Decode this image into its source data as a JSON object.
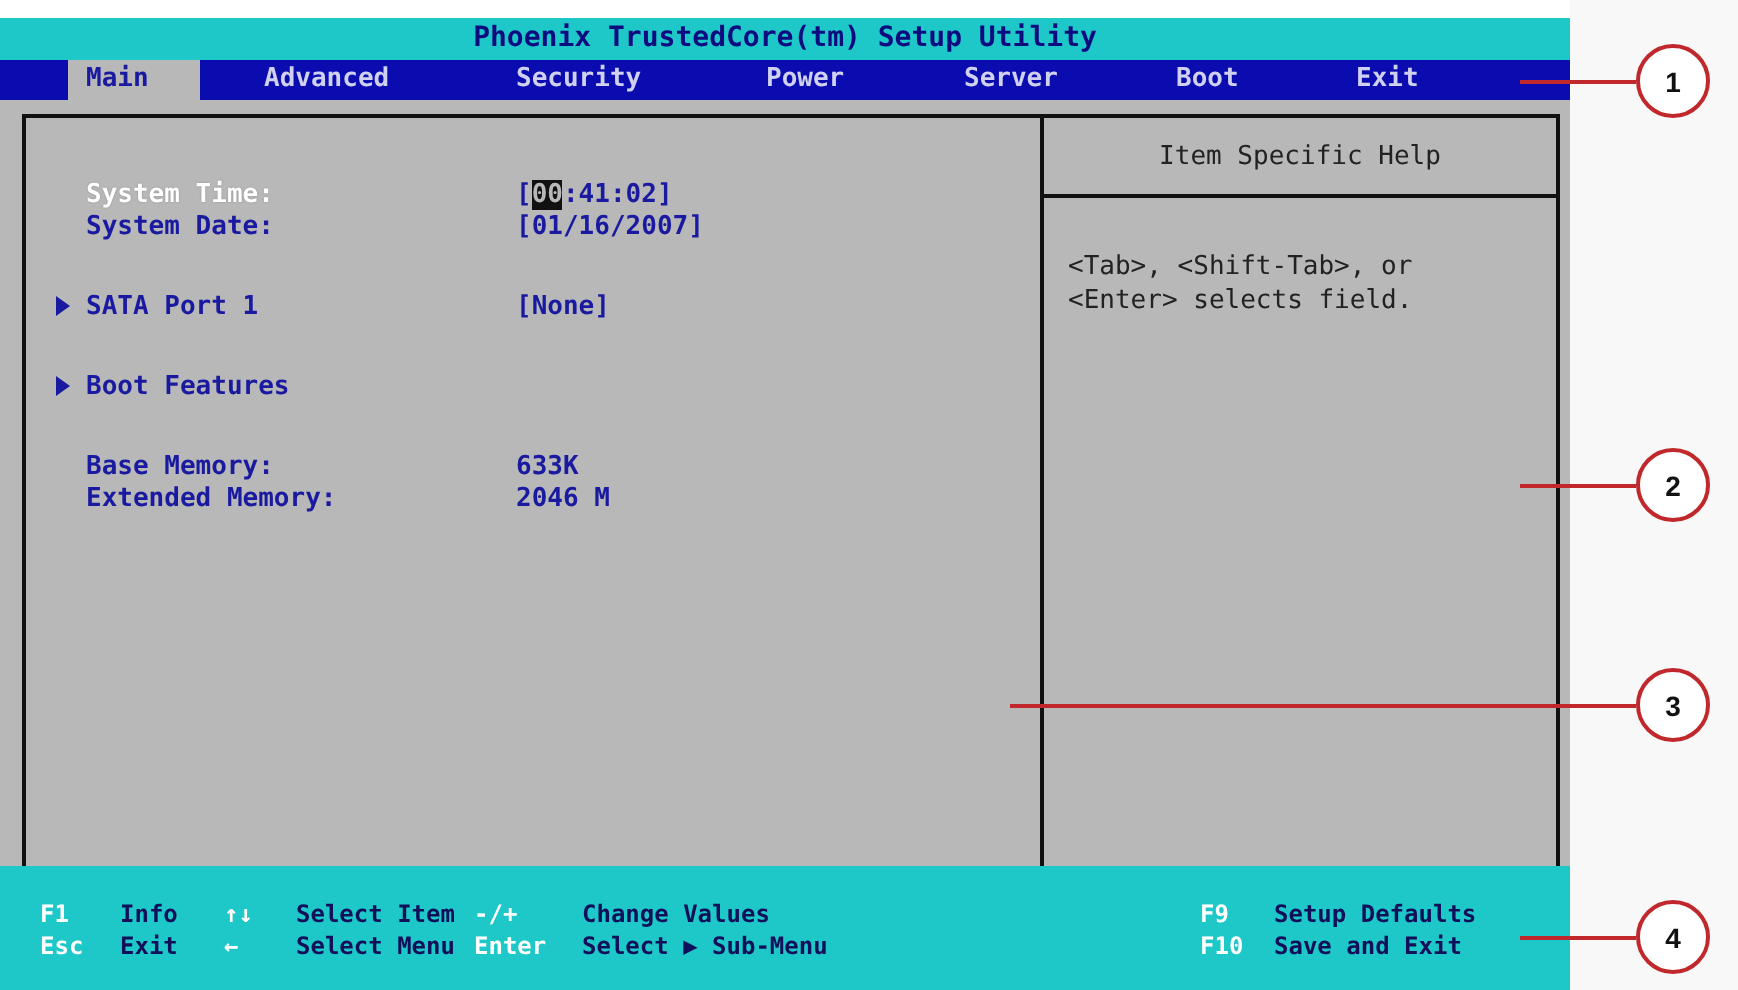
{
  "window": {
    "title": "Phoenix TrustedCore(tm) Setup Utility"
  },
  "menu": [
    {
      "label": "Main",
      "selected": true
    },
    {
      "label": "Advanced",
      "selected": false
    },
    {
      "label": "Security",
      "selected": false
    },
    {
      "label": "Power",
      "selected": false
    },
    {
      "label": "Server",
      "selected": false
    },
    {
      "label": "Boot",
      "selected": false
    },
    {
      "label": "Exit",
      "selected": false
    }
  ],
  "items": [
    {
      "kind": "field",
      "label": "System Time:",
      "selected": true,
      "value_parts": [
        {
          "text": "[",
          "selected": false
        },
        {
          "text": "00",
          "selected": true
        },
        {
          "text": ":41:02]",
          "selected": false
        }
      ]
    },
    {
      "kind": "field",
      "label": "System Date:",
      "selected": false,
      "value_parts": [
        {
          "text": "[01/16/2007]",
          "selected": false
        }
      ]
    },
    {
      "kind": "submenu",
      "label": "SATA Port 1",
      "selected": false,
      "value_parts": [
        {
          "text": "[None]",
          "selected": false
        }
      ]
    },
    {
      "kind": "submenu",
      "label": "Boot Features",
      "selected": false
    },
    {
      "kind": "info",
      "label": "Base Memory:",
      "selected": false,
      "value_parts": [
        {
          "text": "633K",
          "selected": false
        }
      ]
    },
    {
      "kind": "info",
      "label": "Extended Memory:",
      "selected": false,
      "value_parts": [
        {
          "text": "2046 M",
          "selected": false
        }
      ]
    }
  ],
  "help": {
    "title": "Item Specific Help",
    "text": [
      "<Tab>, <Shift-Tab>, or",
      "<Enter> selects field."
    ]
  },
  "status_bar": [
    [
      {
        "key": "F1",
        "action": "Info"
      },
      {
        "key": "↑↓",
        "action": "Select Item"
      },
      {
        "key": "-/+",
        "action": "Change Values"
      },
      {
        "key": "F9",
        "action": "Setup Defaults"
      }
    ],
    [
      {
        "key": "Esc",
        "action": "Exit"
      },
      {
        "key": "←",
        "action": "Select Menu"
      },
      {
        "key": "Enter",
        "action": "Select ▶ Sub-Menu"
      },
      {
        "key": "F10",
        "action": "Save and Exit"
      }
    ]
  ],
  "callouts": [
    {
      "number": "1"
    },
    {
      "number": "2"
    },
    {
      "number": "3"
    },
    {
      "number": "4"
    }
  ]
}
